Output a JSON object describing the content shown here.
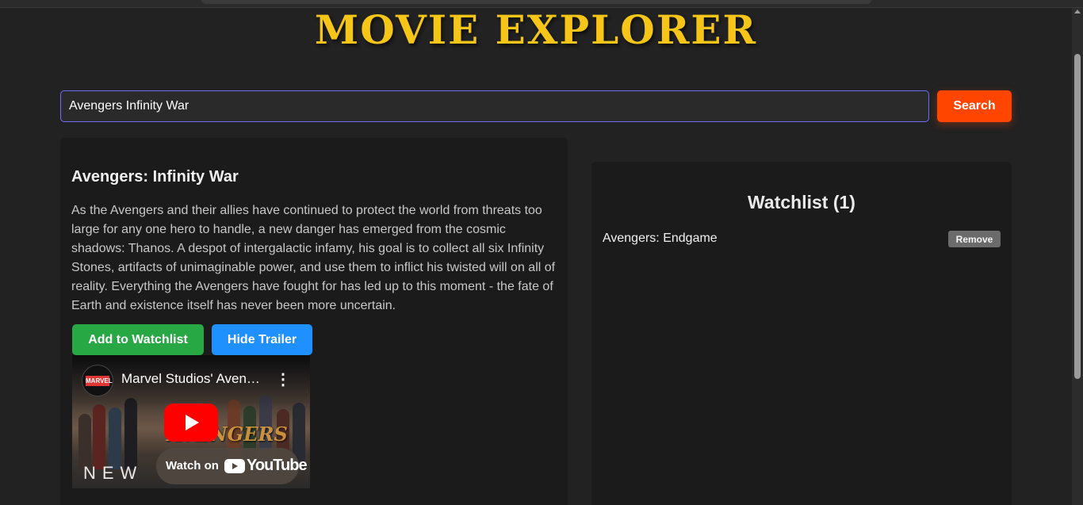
{
  "app": {
    "title": "MOVIE EXPLORER"
  },
  "search": {
    "value": "Avengers Infinity War",
    "button_label": "Search"
  },
  "movie": {
    "title": "Avengers: Infinity War",
    "overview": "As the Avengers and their allies have continued to protect the world from threats too large for any one hero to handle, a new danger has emerged from the cosmic shadows: Thanos. A despot of intergalactic infamy, his goal is to collect all six Infinity Stones, artifacts of unimaginable power, and use them to inflict his twisted will on all of reality. Everything the Avengers have fought for has led up to this moment - the fate of Earth and existence itself has never been more uncertain.",
    "add_button_label": "Add to Watchlist",
    "trailer_button_label": "Hide Trailer"
  },
  "trailer": {
    "channel_logo_text": "MARVEL",
    "video_title": "Marvel Studios' Avengers: Infinity War",
    "watch_on_label": "Watch on",
    "youtube_label": "YouTube",
    "poster_logo_text": "AVENGERS",
    "poster_caption": "NEW"
  },
  "watchlist": {
    "heading": "Watchlist (1)",
    "items": [
      {
        "title": "Avengers: Endgame",
        "remove_label": "Remove"
      }
    ]
  },
  "colors": {
    "title_gold": "#f5c518",
    "search_orange": "#ff4500",
    "add_green": "#28a745",
    "trailer_blue": "#1e90ff",
    "youtube_red": "#ff0000"
  }
}
